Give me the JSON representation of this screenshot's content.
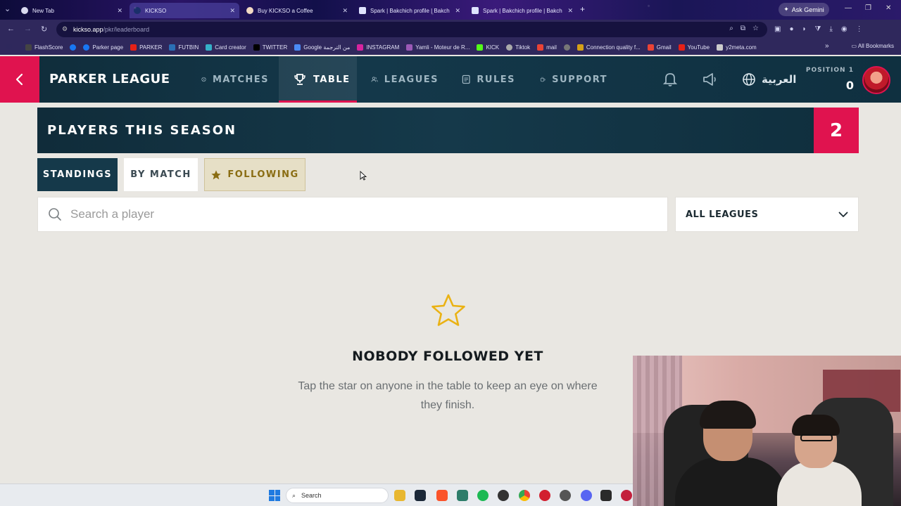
{
  "browser": {
    "tabs": [
      {
        "title": "New Tab",
        "active": false
      },
      {
        "title": "KICKSO",
        "active": true
      },
      {
        "title": "Buy KICKSO a Coffee",
        "active": false
      },
      {
        "title": "Spark | Bakchich profile | Bakch",
        "active": false
      },
      {
        "title": "Spark | Bakchich profile | Bakch",
        "active": false
      }
    ],
    "ask_gemini": "Ask Gemini",
    "url_domain": "kickso.app",
    "url_path": "/pkr/leaderboard",
    "bookmarks": [
      "FlashScore",
      "Parker page",
      "PARKER",
      "FUTBIN",
      "Card creator",
      "TWITTER",
      "Google من الترجمة",
      "INSTAGRAM",
      "Yamli - Moteur de R...",
      "KICK",
      "Tiktok",
      "mail",
      "Connection quality f...",
      "Gmail",
      "YouTube",
      "y2meta.com"
    ],
    "all_bookmarks": "All Bookmarks"
  },
  "header": {
    "brand": "PARKER LEAGUE",
    "nav": [
      {
        "label": "MATCHES",
        "icon": "ball-icon",
        "active": false
      },
      {
        "label": "TABLE",
        "icon": "trophy-icon",
        "active": true
      },
      {
        "label": "LEAGUES",
        "icon": "users-icon",
        "active": false
      },
      {
        "label": "RULES",
        "icon": "document-icon",
        "active": false
      },
      {
        "label": "SUPPORT",
        "icon": "coffee-icon",
        "active": false
      }
    ],
    "language": "العربية",
    "position_label": "POSITION 1",
    "position_value": "0",
    "accent_color": "#e0134f"
  },
  "banner": {
    "title": "PLAYERS THIS SEASON",
    "count": "2"
  },
  "tabs": {
    "standings": "STANDINGS",
    "by_match": "BY MATCH",
    "following": "FOLLOWING",
    "active": "following"
  },
  "search": {
    "placeholder": "Search a player",
    "value": ""
  },
  "league_filter": {
    "selected": "ALL LEAGUES"
  },
  "empty_state": {
    "icon": "star-outline-icon",
    "title": "NOBODY FOLLOWED YET",
    "message": "Tap the star on anyone in the table to keep an eye on where they finish."
  },
  "taskbar": {
    "search_label": "Search"
  }
}
